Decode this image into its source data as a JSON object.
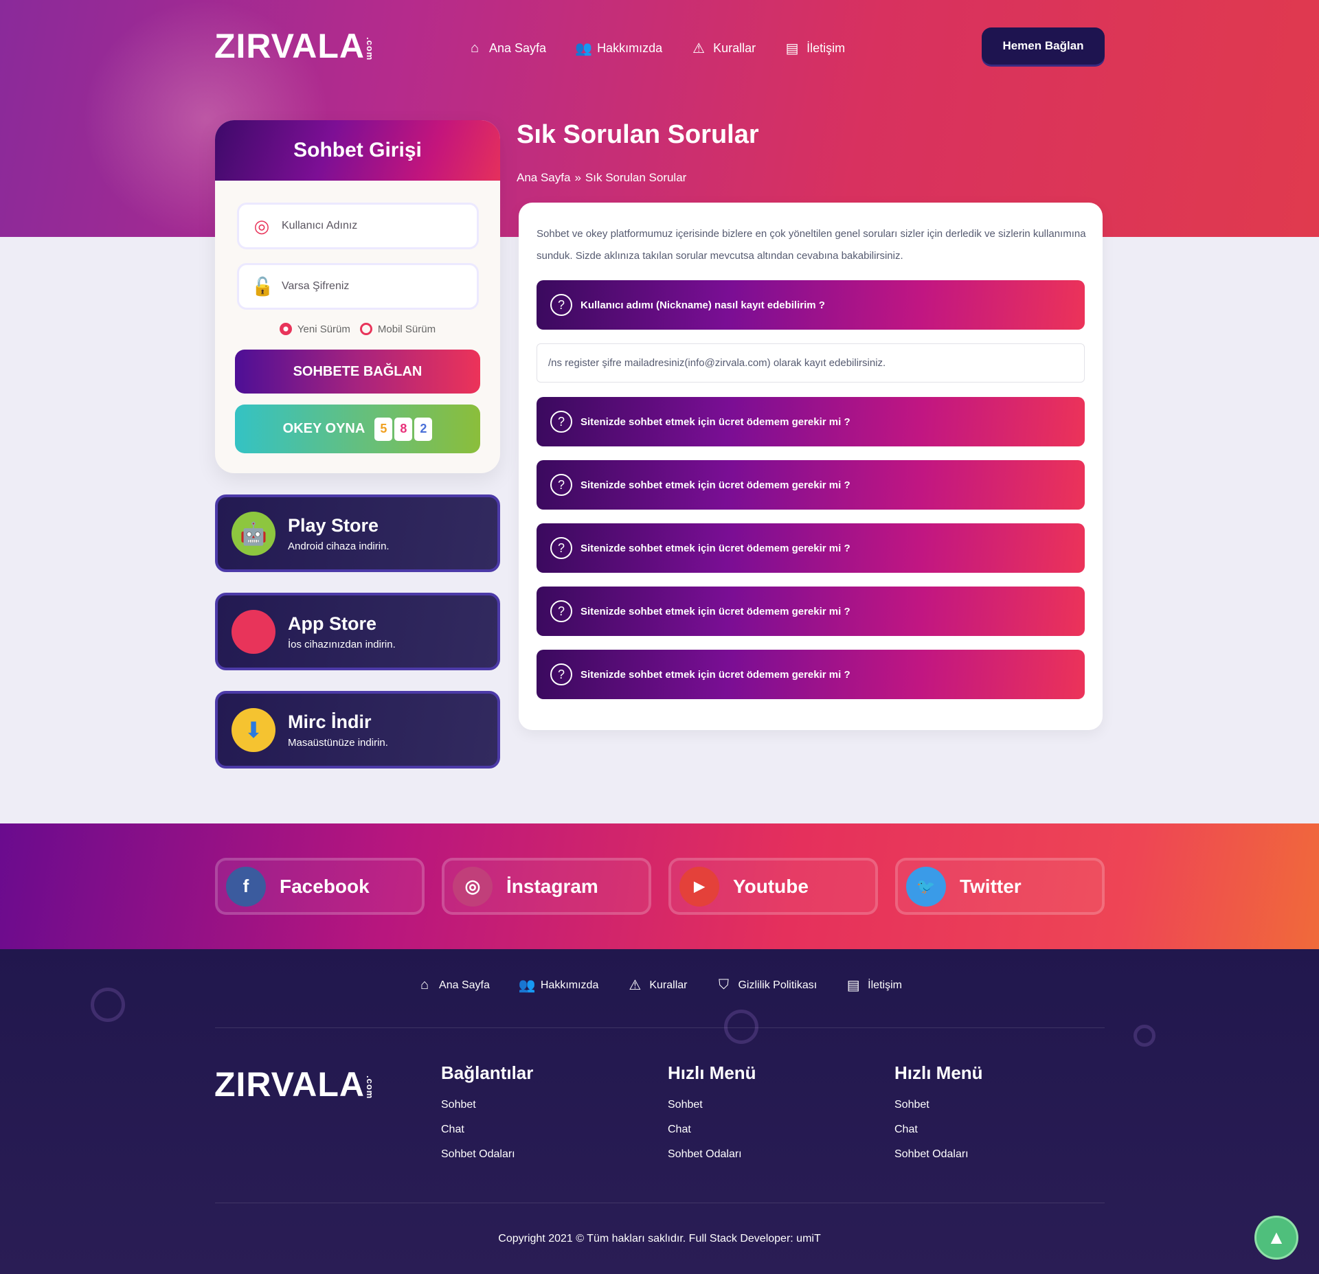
{
  "brand": {
    "logo": "ZIRVALA",
    "logo_suffix": ".com"
  },
  "nav": [
    {
      "label": "Ana Sayfa",
      "icon": "home-icon"
    },
    {
      "label": "Hakkımızda",
      "icon": "users-icon"
    },
    {
      "label": "Kurallar",
      "icon": "warning-icon"
    },
    {
      "label": "İletişim",
      "icon": "chat-icon"
    }
  ],
  "cta": "Hemen Bağlan",
  "login": {
    "title": "Sohbet Girişi",
    "username_placeholder": "Kullanıcı Adınız",
    "password_placeholder": "Varsa Şifreniz",
    "radio_new": "Yeni Sürüm",
    "radio_mobile": "Mobil Sürüm",
    "selected": "Yeni Sürüm",
    "connect": "SOHBETE BAĞLAN",
    "okey": "OKEY OYNA",
    "tiles": [
      "5",
      "8",
      "2"
    ]
  },
  "apps": [
    {
      "title": "Play Store",
      "sub": "Android cihaza indirin.",
      "icon": "android-icon",
      "color": "#8dc63f"
    },
    {
      "title": "App Store",
      "sub": "İos cihazınızdan indirin.",
      "icon": "apple-icon",
      "color": "#e8345a"
    },
    {
      "title": "Mirc İndir",
      "sub": "Masaüstünüze indirin.",
      "icon": "download-icon",
      "color": "#f5c330"
    }
  ],
  "page": {
    "title": "Sık Sorulan Sorular",
    "breadcrumb": [
      "Ana Sayfa",
      "Sık Sorulan Sorular"
    ],
    "separator": "»"
  },
  "faq": {
    "intro": "Sohbet ve okey platformumuz içerisinde bizlere en çok yöneltilen genel soruları sizler için derledik ve sizlerin kullanımına sunduk. Sizde aklınıza takılan sorular mevcutsa altından cevabına bakabilirsiniz.",
    "items": [
      {
        "q": "Kullanıcı adımı (Nickname) nasıl kayıt edebilirim ?",
        "a": "/ns register şifre mailadresiniz(info@zirvala.com) olarak kayıt edebilirsiniz.",
        "open": true
      },
      {
        "q": "Sitenizde sohbet etmek için ücret ödemem gerekir mi ?"
      },
      {
        "q": "Sitenizde sohbet etmek için ücret ödemem gerekir mi ?"
      },
      {
        "q": "Sitenizde sohbet etmek için ücret ödemem gerekir mi ?"
      },
      {
        "q": "Sitenizde sohbet etmek için ücret ödemem gerekir mi ?"
      },
      {
        "q": "Sitenizde sohbet etmek için ücret ödemem gerekir mi ?"
      }
    ]
  },
  "social": [
    {
      "label": "Facebook",
      "glyph": "f",
      "color": "#3b5b9e"
    },
    {
      "label": "İnstagram",
      "glyph": "◎",
      "color": "#c13f7a"
    },
    {
      "label": "Youtube",
      "glyph": "▶",
      "color": "#e4413a"
    },
    {
      "label": "Twitter",
      "glyph": "🐦",
      "color": "#3a9be8"
    }
  ],
  "footer": {
    "nav": [
      {
        "label": "Ana Sayfa",
        "icon": "home-icon"
      },
      {
        "label": "Hakkımızda",
        "icon": "users-icon"
      },
      {
        "label": "Kurallar",
        "icon": "warning-icon"
      },
      {
        "label": "Gizlilik Politikası",
        "icon": "shield-icon"
      },
      {
        "label": "İletişim",
        "icon": "chat-icon"
      }
    ],
    "columns": [
      {
        "title": "Bağlantılar",
        "links": [
          "Sohbet",
          "Chat",
          "Sohbet Odaları"
        ]
      },
      {
        "title": "Hızlı Menü",
        "links": [
          "Sohbet",
          "Chat",
          "Sohbet Odaları"
        ]
      },
      {
        "title": "Hızlı Menü",
        "links": [
          "Sohbet",
          "Chat",
          "Sohbet Odaları"
        ]
      }
    ],
    "copyright": "Copyright 2021 © Tüm hakları saklıdır. Full Stack Developer: umiT"
  }
}
